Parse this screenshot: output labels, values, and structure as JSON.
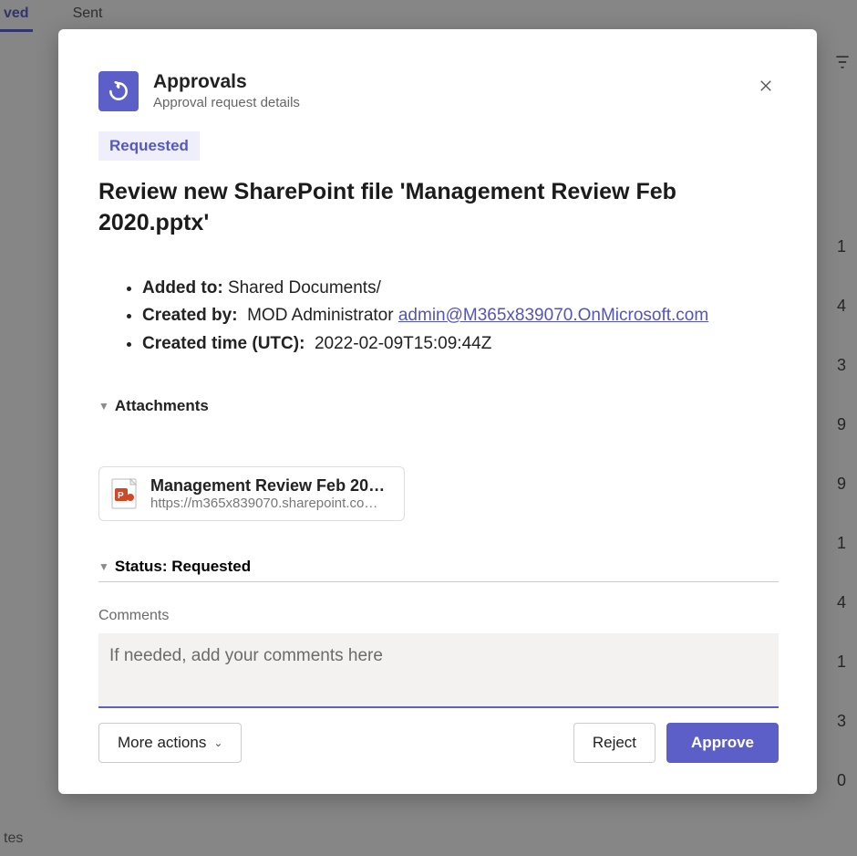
{
  "backdrop": {
    "tab_received": "ved",
    "tab_sent": "Sent",
    "row_values": [
      "1",
      "4",
      "3",
      "9",
      "9",
      "1",
      "4",
      "1",
      "3",
      "0"
    ],
    "notes_label": "tes"
  },
  "header": {
    "app_name": "Approvals",
    "subtitle": "Approval request details"
  },
  "status_pill": "Requested",
  "request_title": "Review new SharePoint file 'Management Review Feb 2020.pptx'",
  "details": {
    "added_to_label": "Added to:",
    "added_to_value": "Shared Documents/",
    "created_by_label": "Created by:",
    "created_by_name": "MOD Administrator",
    "created_by_email": "admin@M365x839070.OnMicrosoft.com",
    "created_time_label": "Created time (UTC):",
    "created_time_value": "2022-02-09T15:09:44Z"
  },
  "attachments": {
    "section_label": "Attachments",
    "file_name_display": "Management Review Feb 202…",
    "file_url_display": "https://m365x839070.sharepoint.co…"
  },
  "status_section": {
    "label": "Status: Requested"
  },
  "comments": {
    "label": "Comments",
    "placeholder": "If needed, add your comments here",
    "value": ""
  },
  "footer": {
    "more_actions": "More actions",
    "reject": "Reject",
    "approve": "Approve"
  }
}
